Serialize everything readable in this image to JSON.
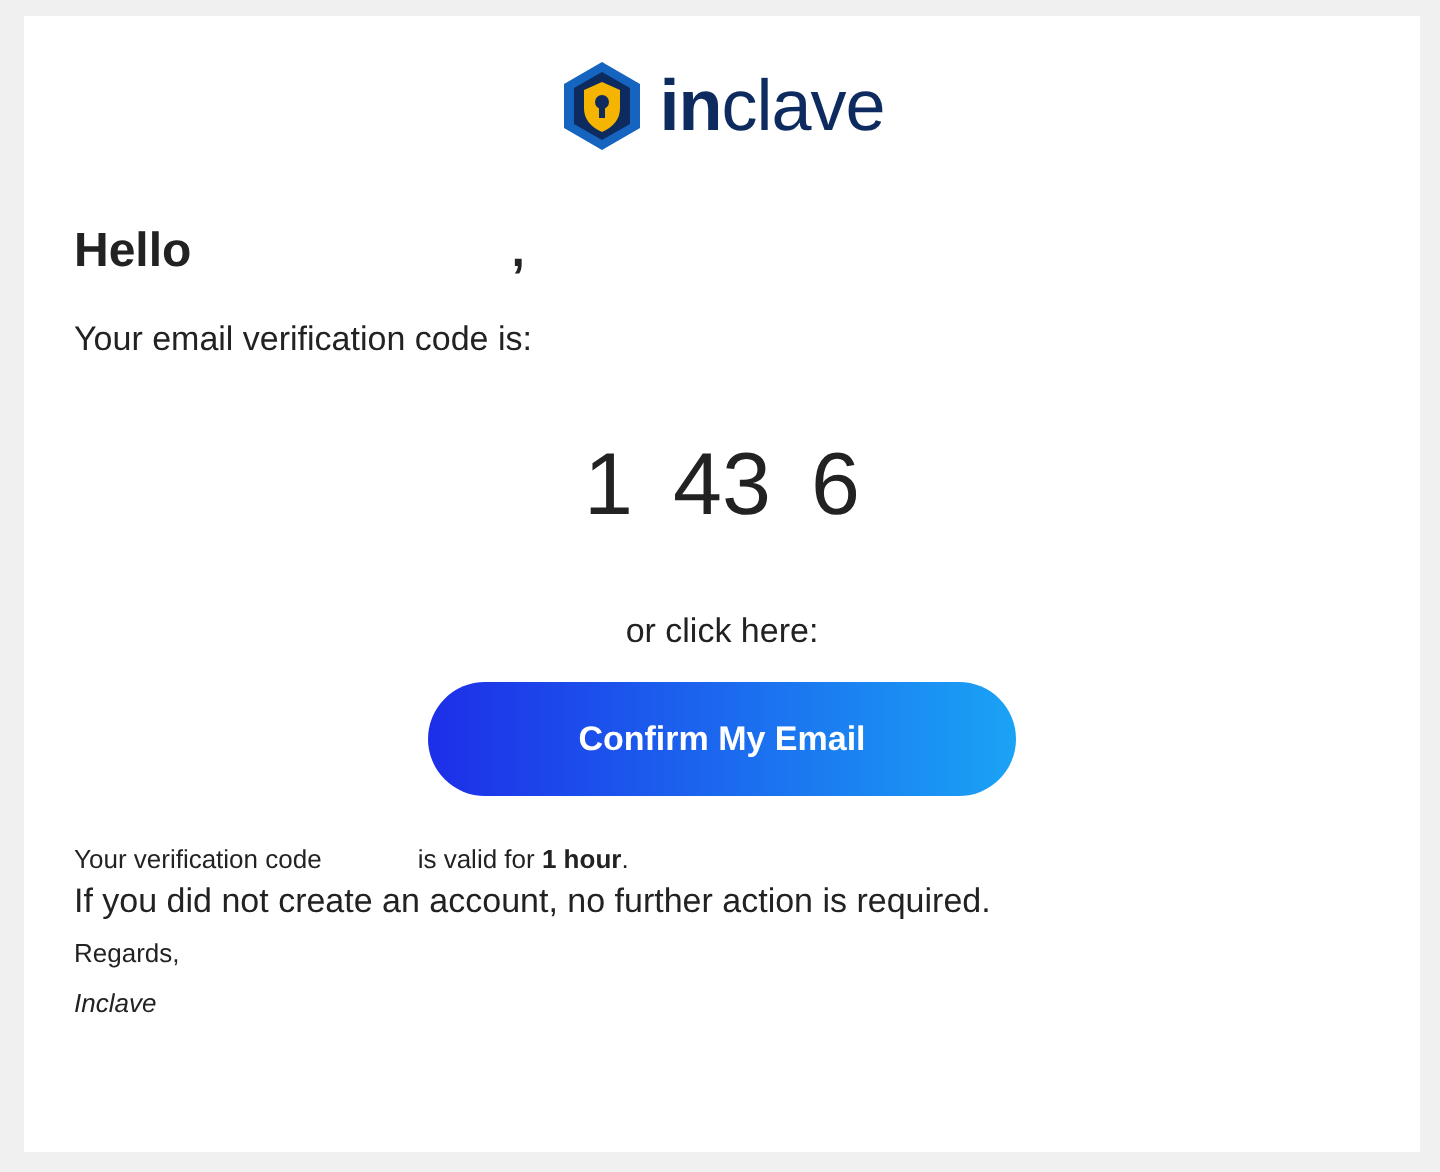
{
  "logo": {
    "text": "**in**clave"
  },
  "greeting": {
    "text": "Hello",
    "suffix": ","
  },
  "intro": "Your email verification code is:",
  "code_parts": [
    "1",
    "43",
    "6"
  ],
  "click_prompt": "or click here:",
  "confirm_button": "Confirm My Email",
  "validity": {
    "before": "Your verification code",
    "after": "is valid for **1 hour**."
  },
  "notice": "If you did not create an account, no further action is required.",
  "regards": "Regards,",
  "signature": "Inclave"
}
